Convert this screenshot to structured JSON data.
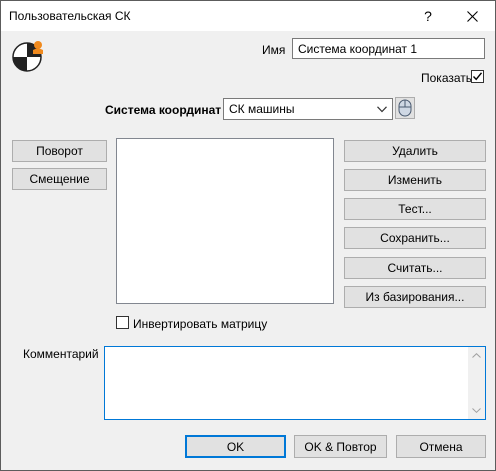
{
  "window": {
    "title": "Пользовательская СК",
    "help_label": "?"
  },
  "name_field": {
    "label": "Имя",
    "value": "Система координат 1"
  },
  "show": {
    "label": "Показать",
    "checked": true
  },
  "coord_system": {
    "label": "Система координат",
    "selected": "СК машины"
  },
  "left_buttons": {
    "rotate": "Поворот",
    "offset": "Смещение"
  },
  "right_buttons": {
    "delete": "Удалить",
    "edit": "Изменить",
    "test": "Тест...",
    "save": "Сохранить...",
    "read": "Считать...",
    "from_base": "Из базирования..."
  },
  "invert_matrix": {
    "label": "Инвертировать матрицу",
    "checked": false
  },
  "comment": {
    "label": "Комментарий",
    "value": ""
  },
  "footer": {
    "ok": "OK",
    "ok_repeat": "OK & Повтор",
    "cancel": "Отмена"
  },
  "colors": {
    "accent": "#0078d7",
    "logo_orange": "#f08a1e"
  },
  "icons": {
    "app_logo": "coordinate-system-logo-icon",
    "pick": "mouse-pick-icon",
    "dropdown": "chevron-down-icon",
    "check": "checkmark-icon"
  }
}
